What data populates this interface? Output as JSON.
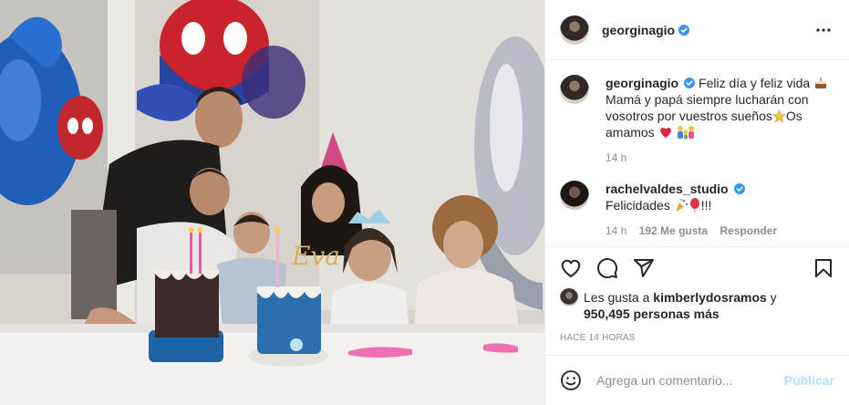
{
  "post": {
    "author": "georginagio",
    "verified": true,
    "caption": {
      "line1": "Feliz día y feliz vida",
      "line2": "Mamá y papá siempre lucharán con",
      "line3": "vosotros por vuestros sueños",
      "line3_end": "Os",
      "line4": "amamos"
    },
    "caption_time": "14 h",
    "comment": {
      "author": "rachelvaldes_studio",
      "text": "Felicidades",
      "text_end": "!!!",
      "time": "14 h",
      "likes": "192 Me gusta",
      "reply": "Responder"
    },
    "likes": {
      "prefix": "Les gusta a",
      "user": "kimberlydosramos",
      "joiner": "y",
      "count": "950,495 personas más"
    },
    "posted_ago": "HACE 14 HORAS",
    "add_comment": {
      "placeholder": "Agrega un comentario...",
      "publish_label": "Publicar"
    },
    "cake_topper": "Eva"
  },
  "colors": {
    "verified": "#3897f0",
    "publish_disabled": "#b2dffc",
    "secondary_text": "#8e8e8e"
  },
  "icons": [
    "more-options-icon",
    "heart-icon",
    "comment-icon",
    "share-icon",
    "bookmark-icon",
    "smile-icon"
  ]
}
